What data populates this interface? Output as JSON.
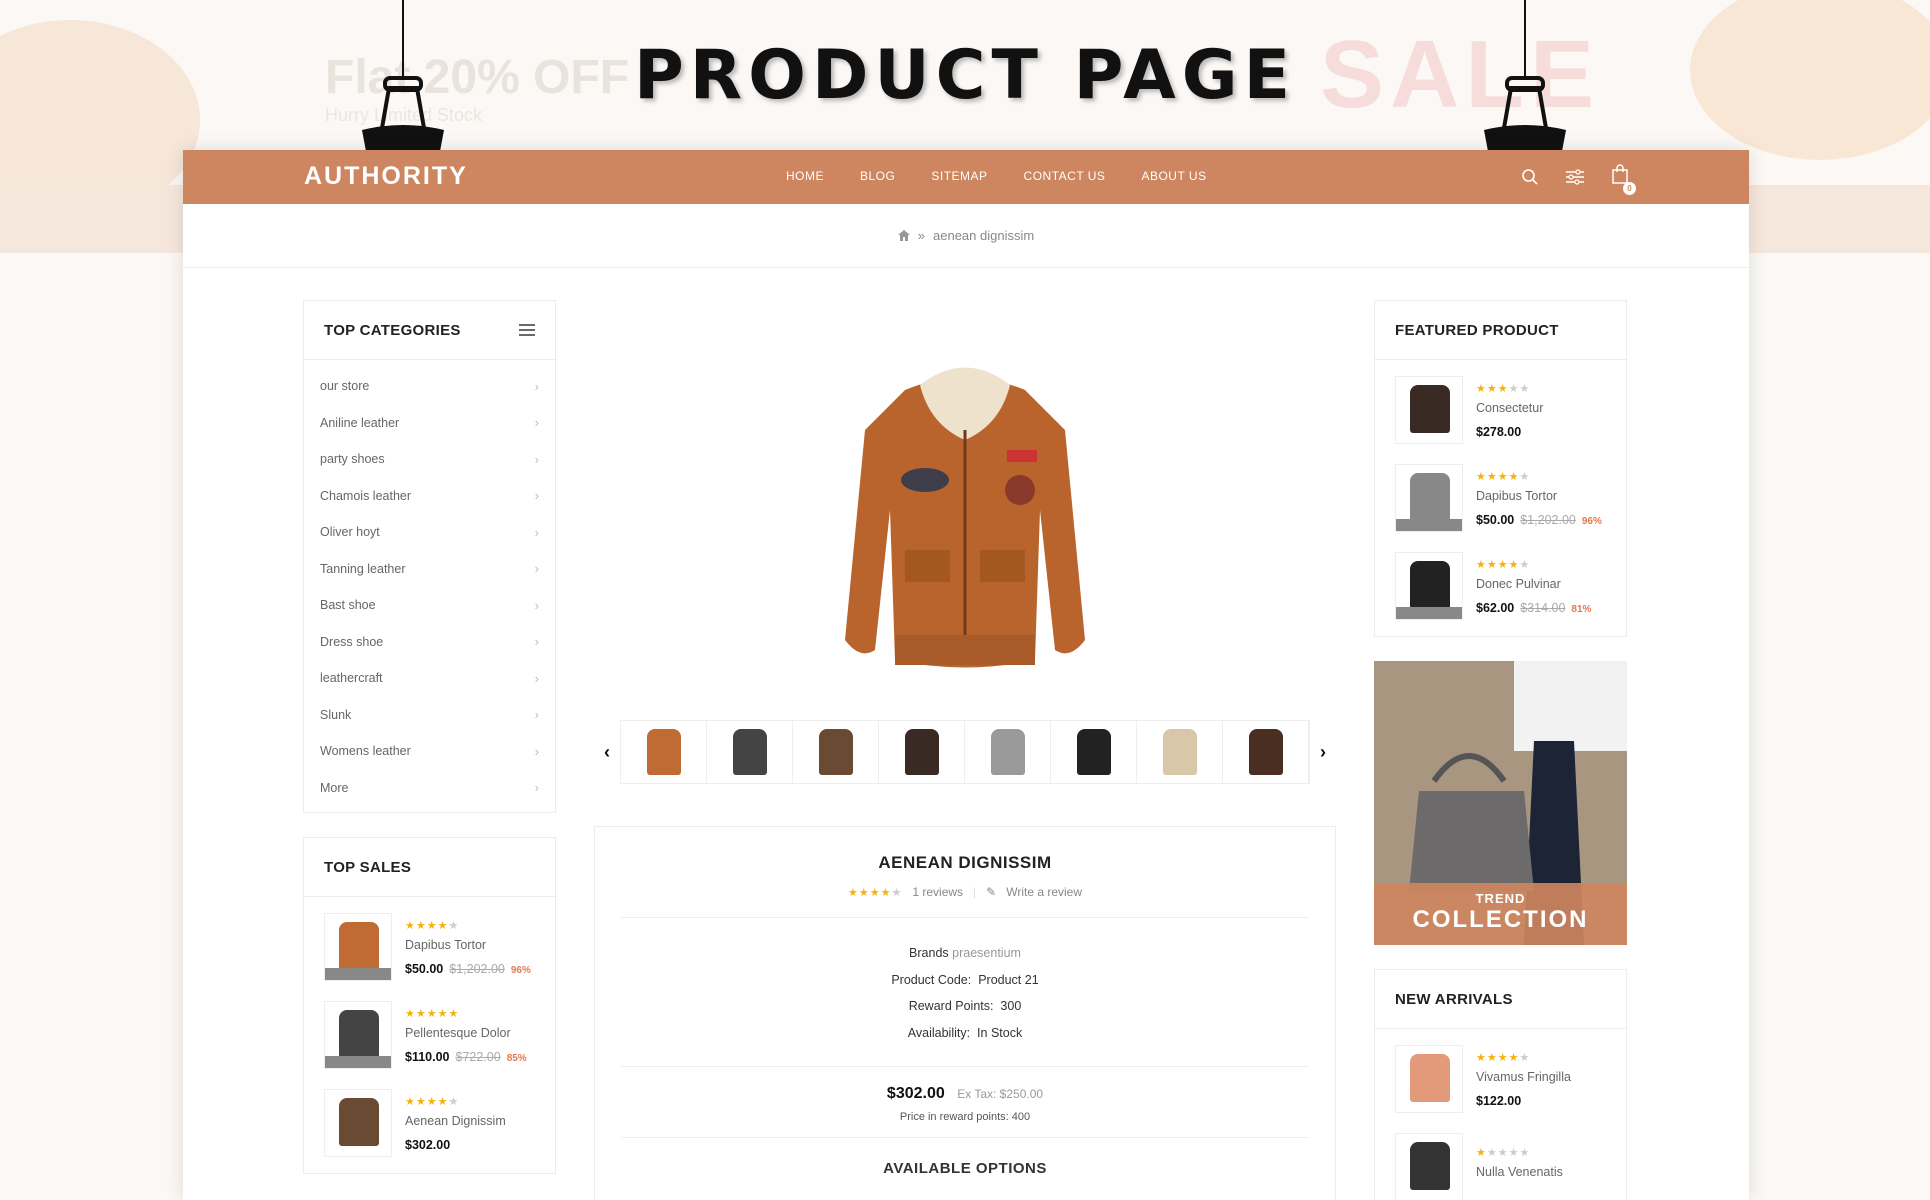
{
  "banner": {
    "title": "PRODUCT PAGE",
    "bg_flat_text": "Flat 20% OFF",
    "bg_hurry_text": "Hurry Limited Stock",
    "bg_sale_text": "SALE"
  },
  "header": {
    "logo": "AUTHORITY",
    "menu": [
      "HOME",
      "BLOG",
      "SITEMAP",
      "CONTACT US",
      "ABOUT US"
    ],
    "cart_count": "0",
    "accent": "#cd865f"
  },
  "breadcrumb": {
    "current": "aenean dignissim"
  },
  "categories": {
    "title": "TOP CATEGORIES",
    "items": [
      "our store",
      "Aniline leather",
      "party shoes",
      "Chamois leather",
      "Oliver hoyt",
      "Tanning leather",
      "Bast shoe",
      "Dress shoe",
      "leathercraft",
      "Slunk",
      "Womens leather",
      "More"
    ]
  },
  "top_sales": {
    "title": "TOP SALES",
    "items": [
      {
        "name": "Dapibus Tortor",
        "rating": 4,
        "price": "$50.00",
        "old": "$1,202.00",
        "pct": "96%"
      },
      {
        "name": "Pellentesque Dolor",
        "rating": 5,
        "price": "$110.00",
        "old": "$722.00",
        "pct": "85%"
      },
      {
        "name": "Aenean Dignissim",
        "rating": 4,
        "price": "$302.00"
      }
    ]
  },
  "featured": {
    "title": "FEATURED PRODUCT",
    "items": [
      {
        "name": "Consectetur",
        "rating": 3,
        "price": "$278.00"
      },
      {
        "name": "Dapibus Tortor",
        "rating": 4,
        "price": "$50.00",
        "old": "$1,202.00",
        "pct": "96%"
      },
      {
        "name": "Donec Pulvinar",
        "rating": 4,
        "price": "$62.00",
        "old": "$314.00",
        "pct": "81%"
      }
    ]
  },
  "trend": {
    "line1": "TREND",
    "line2": "COLLECTION"
  },
  "new_arrivals": {
    "title": "NEW ARRIVALS",
    "items": [
      {
        "name": "Vivamus Fringilla",
        "rating": 4,
        "price": "$122.00"
      },
      {
        "name": "Nulla Venenatis",
        "rating": 1,
        "price": ""
      }
    ]
  },
  "product": {
    "name": "AENEAN DIGNISSIM",
    "rating": 4,
    "reviews": "1 reviews",
    "write_review": "Write a review",
    "brand_label": "Brands",
    "brand": "praesentium",
    "code_label": "Product Code:",
    "code": "Product 21",
    "points_label": "Reward Points:",
    "points": "300",
    "avail_label": "Availability:",
    "avail": "In Stock",
    "price": "$302.00",
    "ex_tax": "Ex Tax: $250.00",
    "reward_price": "Price in reward points: 400",
    "options_title": "AVAILABLE OPTIONS"
  },
  "gallery": {
    "thumbs": [
      "brown-jacket",
      "black-suitcase",
      "aviator-jacket",
      "black-brown-jacket",
      "varsity-jacket",
      "black-leather-jacket",
      "cream-jacket",
      "dark-brown-jacket"
    ]
  }
}
